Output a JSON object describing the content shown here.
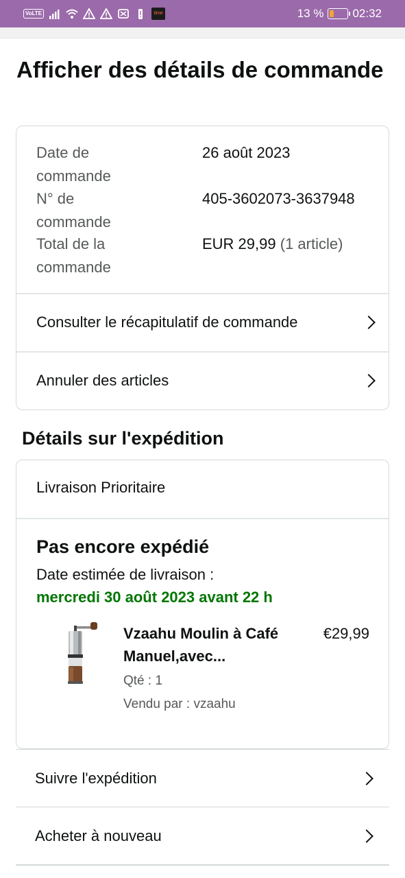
{
  "status_bar": {
    "volte": "VoLTE",
    "time_app_label": "time",
    "battery_text": "13 %",
    "battery_level_percent": 13,
    "clock": "02:32",
    "icons": [
      "signal-icon",
      "wifi-icon",
      "warning-icon",
      "warning-icon",
      "notification-icon",
      "battery-alert-icon",
      "time-app-icon"
    ]
  },
  "page": {
    "title": "Afficher des détails de commande"
  },
  "order": {
    "date_label": "Date de commande",
    "date_value": "26 août 2023",
    "number_label": "N° de commande",
    "number_value": "405-3602073-3637948",
    "total_label": "Total de la commande",
    "total_value": "EUR 29,99",
    "total_items": "(1 article)",
    "summary_link": "Consulter le récapitulatif de commande",
    "cancel_link": "Annuler des articles"
  },
  "shipment": {
    "section_title": "Détails sur l'expédition",
    "method": "Livraison Prioritaire",
    "status": "Pas encore expédié",
    "estimate_label": "Date estimée de livraison :",
    "estimate_date": "mercredi 30 août 2023 avant 22 h",
    "item": {
      "title": "Vzaahu Moulin à Café Manuel,avec...",
      "price": "€29,99",
      "quantity": "Qté : 1",
      "seller": "Vendu par : vzaahu"
    }
  },
  "actions": {
    "track": "Suivre l'expédition",
    "buy_again": "Acheter à nouveau"
  },
  "colors": {
    "status_bar": "#9b6aaa",
    "delivery_green": "#007600",
    "battery_low": "#f3a430"
  }
}
